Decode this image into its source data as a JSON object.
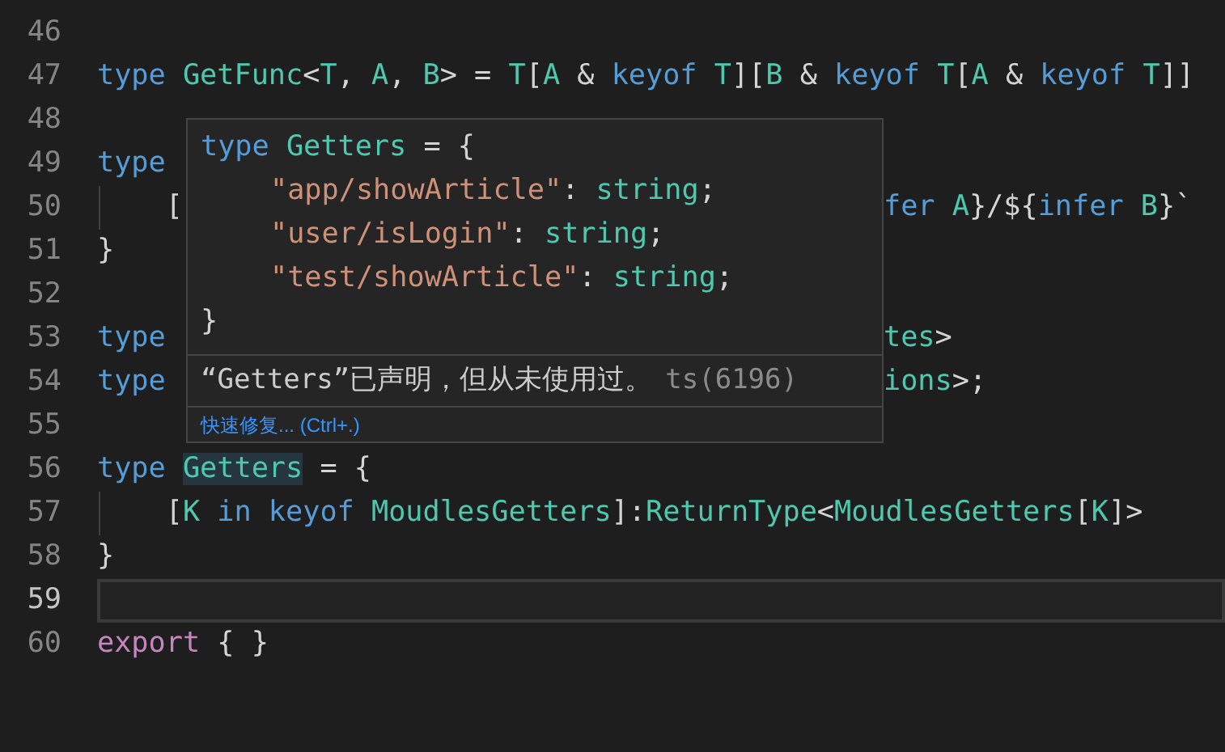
{
  "editor": {
    "lines": [
      {
        "number": "46",
        "current": false
      },
      {
        "number": "47",
        "current": false,
        "tokens": [
          {
            "text": "type ",
            "kind": "keyword"
          },
          {
            "text": "GetFunc",
            "kind": "type"
          },
          {
            "text": "<",
            "kind": "punct"
          },
          {
            "text": "T",
            "kind": "type"
          },
          {
            "text": ", ",
            "kind": "punct"
          },
          {
            "text": "A",
            "kind": "type"
          },
          {
            "text": ", ",
            "kind": "punct"
          },
          {
            "text": "B",
            "kind": "type"
          },
          {
            "text": "> = ",
            "kind": "punct"
          },
          {
            "text": "T",
            "kind": "type"
          },
          {
            "text": "[",
            "kind": "punct"
          },
          {
            "text": "A",
            "kind": "type"
          },
          {
            "text": " & ",
            "kind": "punct"
          },
          {
            "text": "keyof ",
            "kind": "keyword"
          },
          {
            "text": "T",
            "kind": "type"
          },
          {
            "text": "][",
            "kind": "punct"
          },
          {
            "text": "B",
            "kind": "type"
          },
          {
            "text": " & ",
            "kind": "punct"
          },
          {
            "text": "keyof ",
            "kind": "keyword"
          },
          {
            "text": "T",
            "kind": "type"
          },
          {
            "text": "[",
            "kind": "punct"
          },
          {
            "text": "A",
            "kind": "type"
          },
          {
            "text": " & ",
            "kind": "punct"
          },
          {
            "text": "keyof ",
            "kind": "keyword"
          },
          {
            "text": "T",
            "kind": "type"
          },
          {
            "text": "]]",
            "kind": "punct"
          }
        ]
      },
      {
        "number": "48",
        "current": false
      },
      {
        "number": "49",
        "current": false,
        "tokens": [
          {
            "text": "type",
            "kind": "keyword"
          }
        ]
      },
      {
        "number": "50",
        "current": false,
        "guide": true,
        "tokens": [
          {
            "text": "    [",
            "kind": "punct"
          }
        ],
        "right_tokens": [
          {
            "text": "fer ",
            "kind": "keyword"
          },
          {
            "text": "A",
            "kind": "type"
          },
          {
            "text": "}/${",
            "kind": "punct"
          },
          {
            "text": "infer ",
            "kind": "keyword"
          },
          {
            "text": "B",
            "kind": "type"
          },
          {
            "text": "}`",
            "kind": "punct"
          }
        ]
      },
      {
        "number": "51",
        "current": false,
        "tokens": [
          {
            "text": "}",
            "kind": "punct"
          }
        ]
      },
      {
        "number": "52",
        "current": false
      },
      {
        "number": "53",
        "current": false,
        "tokens": [
          {
            "text": "type",
            "kind": "keyword"
          }
        ],
        "right_tokens": [
          {
            "text": "tes",
            "kind": "type"
          },
          {
            "text": ">",
            "kind": "punct"
          }
        ]
      },
      {
        "number": "54",
        "current": false,
        "tokens": [
          {
            "text": "type",
            "kind": "keyword"
          }
        ],
        "right_tokens": [
          {
            "text": "ions",
            "kind": "type"
          },
          {
            "text": ">;",
            "kind": "punct"
          }
        ]
      },
      {
        "number": "55",
        "current": false
      },
      {
        "number": "56",
        "current": false,
        "tokens": [
          {
            "text": "type ",
            "kind": "keyword"
          },
          {
            "text": "Getters",
            "kind": "highlight"
          },
          {
            "text": " = {",
            "kind": "punct"
          }
        ]
      },
      {
        "number": "57",
        "current": false,
        "guide": true,
        "tokens": [
          {
            "text": "    [",
            "kind": "punct"
          },
          {
            "text": "K",
            "kind": "type"
          },
          {
            "text": " in keyof ",
            "kind": "keyword"
          },
          {
            "text": "MoudlesGetters",
            "kind": "type"
          },
          {
            "text": "]:",
            "kind": "punct"
          },
          {
            "text": "ReturnType",
            "kind": "type"
          },
          {
            "text": "<",
            "kind": "punct"
          },
          {
            "text": "MoudlesGetters",
            "kind": "type"
          },
          {
            "text": "[",
            "kind": "punct"
          },
          {
            "text": "K",
            "kind": "type"
          },
          {
            "text": "]>",
            "kind": "punct"
          }
        ]
      },
      {
        "number": "58",
        "current": false,
        "tokens": [
          {
            "text": "}",
            "kind": "punct"
          }
        ]
      },
      {
        "number": "59",
        "current": true
      },
      {
        "number": "60",
        "current": false,
        "tokens": [
          {
            "text": "export ",
            "kind": "control"
          },
          {
            "text": "{ }",
            "kind": "punct"
          }
        ]
      }
    ]
  },
  "hover": {
    "code_lines": [
      {
        "indent": false,
        "tokens": [
          {
            "text": "type ",
            "kind": "keyword"
          },
          {
            "text": "Getters",
            "kind": "type"
          },
          {
            "text": " = {",
            "kind": "punct"
          }
        ]
      },
      {
        "indent": true,
        "tokens": [
          {
            "text": "\"app/showArticle\"",
            "kind": "string"
          },
          {
            "text": ": ",
            "kind": "punct"
          },
          {
            "text": "string",
            "kind": "type"
          },
          {
            "text": ";",
            "kind": "punct"
          }
        ]
      },
      {
        "indent": true,
        "tokens": [
          {
            "text": "\"user/isLogin\"",
            "kind": "string"
          },
          {
            "text": ": ",
            "kind": "punct"
          },
          {
            "text": "string",
            "kind": "type"
          },
          {
            "text": ";",
            "kind": "punct"
          }
        ]
      },
      {
        "indent": true,
        "tokens": [
          {
            "text": "\"test/showArticle\"",
            "kind": "string"
          },
          {
            "text": ": ",
            "kind": "punct"
          },
          {
            "text": "string",
            "kind": "type"
          },
          {
            "text": ";",
            "kind": "punct"
          }
        ]
      },
      {
        "indent": false,
        "tokens": [
          {
            "text": "}",
            "kind": "punct"
          }
        ]
      }
    ],
    "message": "“Getters”已声明，但从未使用过。",
    "code": "ts(6196)",
    "quick_fix": "快速修复... (Ctrl+.)"
  }
}
